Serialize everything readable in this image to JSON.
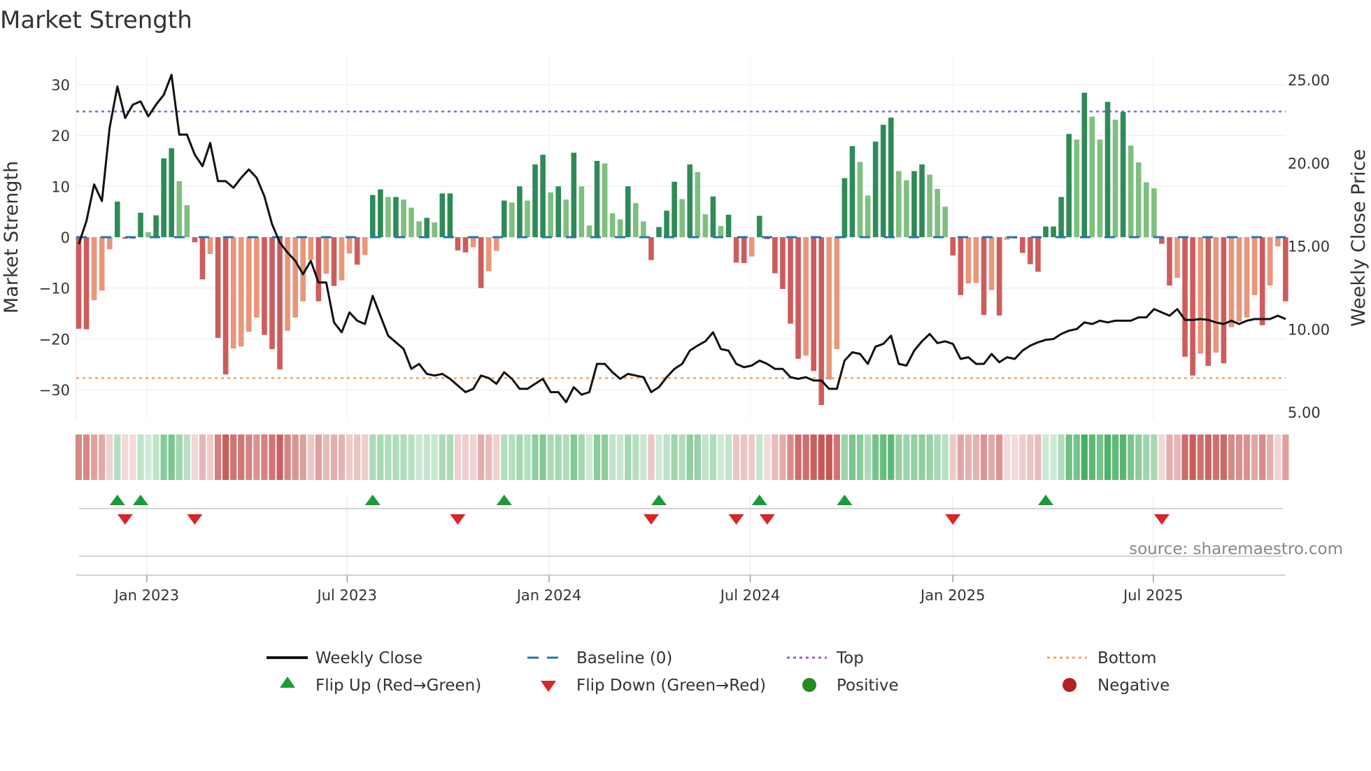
{
  "title": "Market Strength",
  "source_note": "source: sharemaestro.com",
  "colors": {
    "up_strong": "#2e8b57",
    "up_weak": "#7fbf7f",
    "down_strong": "#cd5c5c",
    "down_weak": "#e9967a",
    "close_line": "#111111",
    "baseline": "#1f77b4",
    "top": "#9b59d6",
    "bottom": "#f4a460",
    "flip_up": "#1a9a3a",
    "flip_down": "#d62728",
    "positive": "#228b22",
    "negative": "#b22222"
  },
  "chart_data": {
    "type": "bar+line",
    "title": "Market Strength",
    "ylabel": "Market Strength",
    "y2label": "Weekly Close Price",
    "ylim": [
      -36,
      36
    ],
    "y2lim": [
      3.5,
      27
    ],
    "yticks": [
      30,
      20,
      10,
      0,
      -10,
      -20,
      -30
    ],
    "yticklabels": [
      "30",
      "20",
      "10",
      "0",
      "−10",
      "−20",
      "−30"
    ],
    "y2ticks": [
      25,
      20,
      15,
      10,
      5
    ],
    "y2ticklabels": [
      "25.00",
      "20.00",
      "15.00",
      "10.00",
      "5.00"
    ],
    "top_level": 24.7,
    "bottom_level": -27.7,
    "baseline": 0,
    "x_unit": "week index (weekly, starting early Nov 2022)",
    "xticks": [
      {
        "week": 8.8,
        "label": "Jan 2023"
      },
      {
        "week": 34.7,
        "label": "Jul 2023"
      },
      {
        "week": 60.8,
        "label": "Jan 2024"
      },
      {
        "week": 86.8,
        "label": "Jul 2024"
      },
      {
        "week": 113.0,
        "label": "Jan 2025"
      },
      {
        "week": 138.9,
        "label": "Jul 2025"
      }
    ],
    "strength": [
      -18,
      -18.1,
      -12.4,
      -10.5,
      -2.4,
      7,
      -0.3,
      -0.3,
      4.8,
      1,
      4.3,
      15.5,
      17.5,
      11,
      6.3,
      -1,
      -8.3,
      -3.3,
      -19.8,
      -27,
      -21.9,
      -21.5,
      -18.6,
      -15.8,
      -19.2,
      -22,
      -26,
      -18.4,
      -15.8,
      -12.6,
      -4.5,
      -12.6,
      -7.2,
      -9.6,
      -8.5,
      -3.2,
      -5.4,
      -3.5,
      8.3,
      9.4,
      7.9,
      7.9,
      7.4,
      5.8,
      3.1,
      3.8,
      2.9,
      8.6,
      8.6,
      -2.6,
      -3,
      -2,
      -10,
      -6.7,
      -2.7,
      7.2,
      6.8,
      10,
      7.2,
      14.3,
      16.2,
      8.8,
      10,
      7.4,
      16.6,
      10,
      2.3,
      15,
      14.5,
      4.7,
      3.5,
      10,
      6.7,
      3.1,
      -4.5,
      2,
      5.2,
      10.9,
      7.5,
      14.3,
      12.8,
      4.5,
      8,
      2.2,
      4.4,
      -5,
      -5.1,
      -3.8,
      4.2,
      -0.4,
      -7.1,
      -10.2,
      -17,
      -23.9,
      -23.3,
      -26.3,
      -33,
      -28,
      -22,
      11.6,
      17.9,
      14.8,
      8.2,
      18.8,
      22.1,
      23.5,
      13,
      11.2,
      13,
      14.3,
      12.3,
      9.5,
      6,
      -3.6,
      -11.4,
      -9.1,
      -9,
      -15.3,
      -10.4,
      -15.4,
      -0.5,
      -0.3,
      -3.1,
      -5.3,
      -6.8,
      2.1,
      2.1,
      7.9,
      20.3,
      19.2,
      28.4,
      23.7,
      19.2,
      26.6,
      23.1,
      24.6,
      18,
      14.7,
      10.8,
      9.6,
      -1.3,
      -9.5,
      -8,
      -23.5,
      -27.2,
      -22.9,
      -25.3,
      -22.7,
      -24.8,
      -17.7,
      -16.6,
      -15.8,
      -11.4,
      -17.3,
      -9.5,
      -1.8,
      -12.6
    ],
    "weekly_close": [
      15.1,
      16.5,
      18.7,
      17.7,
      22.1,
      24.6,
      22.7,
      23.5,
      23.7,
      22.8,
      23.5,
      24.1,
      25.3,
      21.7,
      21.7,
      20.5,
      19.8,
      21.2,
      18.9,
      18.9,
      18.5,
      19.1,
      19.6,
      19.1,
      18.0,
      16.3,
      15.2,
      14.6,
      14.1,
      13.3,
      14.1,
      12.8,
      12.8,
      10.4,
      9.8,
      11.0,
      10.5,
      10.3,
      12.0,
      10.8,
      9.6,
      9.2,
      8.8,
      7.6,
      7.9,
      7.3,
      7.2,
      7.3,
      7.0,
      6.6,
      6.2,
      6.4,
      7.2,
      7.05,
      6.7,
      7.4,
      7.0,
      6.4,
      6.4,
      6.7,
      7.0,
      6.2,
      6.2,
      5.6,
      6.5,
      6.05,
      6.2,
      7.9,
      7.9,
      7.4,
      7.0,
      7.3,
      7.2,
      7.1,
      6.2,
      6.5,
      7.1,
      7.6,
      7.9,
      8.7,
      9.0,
      9.26,
      9.8,
      8.8,
      8.7,
      7.9,
      7.7,
      7.8,
      8.1,
      7.9,
      7.6,
      7.6,
      7.1,
      7.0,
      7.1,
      6.9,
      6.9,
      6.4,
      6.4,
      8.1,
      8.6,
      8.5,
      7.9,
      8.94,
      9.1,
      9.6,
      7.9,
      7.8,
      8.7,
      9.26,
      9.7,
      9.15,
      9.26,
      9.1,
      8.2,
      8.3,
      7.9,
      7.9,
      8.5,
      8.0,
      8.3,
      8.2,
      8.7,
      9.0,
      9.2,
      9.35,
      9.4,
      9.7,
      9.9,
      10.0,
      10.4,
      10.3,
      10.5,
      10.4,
      10.5,
      10.5,
      10.5,
      10.7,
      10.7,
      11.2,
      11.0,
      10.8,
      11.2,
      10.55,
      10.55,
      10.6,
      10.55,
      10.4,
      10.3,
      10.5,
      10.3,
      10.5,
      10.6,
      10.6,
      10.6,
      10.8,
      10.6
    ],
    "flip_up_weeks": [
      5,
      8,
      38,
      55,
      75,
      88,
      99,
      125
    ],
    "flip_down_weeks": [
      6,
      15,
      49,
      74,
      85,
      89,
      113,
      140
    ]
  },
  "legend": {
    "weekly_close": "Weekly Close",
    "baseline": "Baseline (0)",
    "top": "Top",
    "bottom": "Bottom",
    "flip_up": "Flip Up (Red→Green)",
    "flip_down": "Flip Down (Green→Red)",
    "positive": "Positive",
    "negative": "Negative"
  }
}
